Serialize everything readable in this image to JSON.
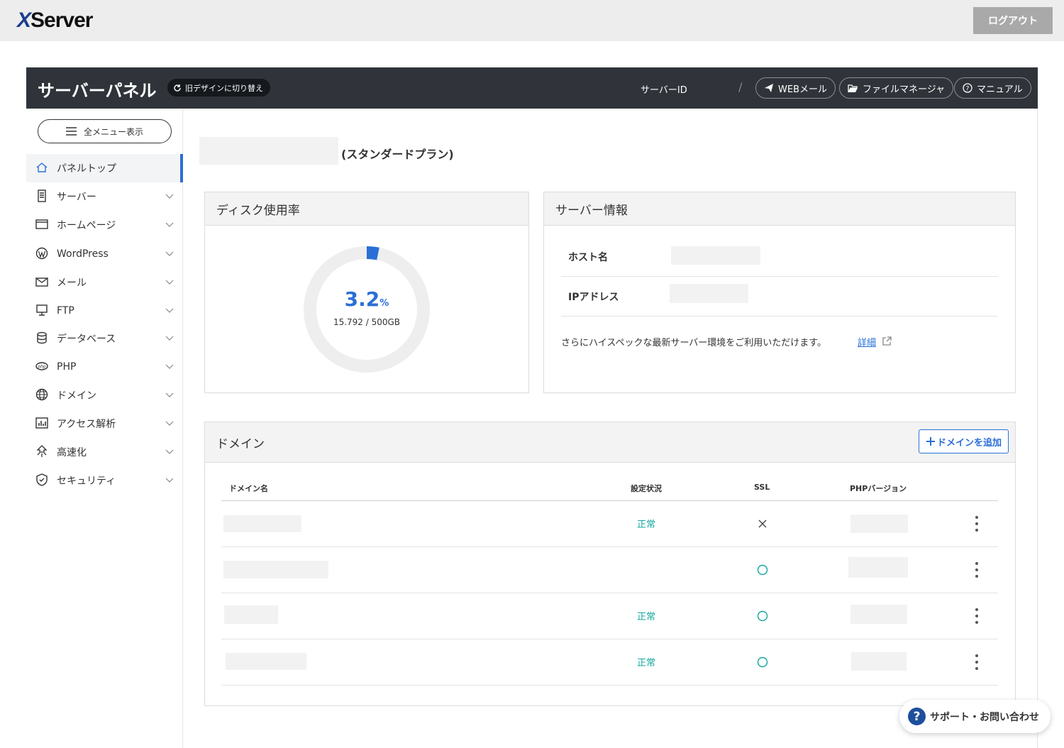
{
  "topbar": {
    "logo": "XServer",
    "logo_x": "X",
    "logo_rest": "Server",
    "logout_label": "ログアウト"
  },
  "panel": {
    "title": "サーバーパネル",
    "switch_label": "旧デザインに切り替え",
    "server_id_label": "サーバーID",
    "separator": "/",
    "buttons": {
      "webmail": "WEBメール",
      "filemanager": "ファイルマネージャ",
      "manual": "マニュアル"
    }
  },
  "sidebar": {
    "menu_button": "全メニュー表示",
    "items": [
      {
        "label": "パネルトップ",
        "icon": "home-icon"
      },
      {
        "label": "サーバー",
        "icon": "server-icon"
      },
      {
        "label": "ホームページ",
        "icon": "browser-icon"
      },
      {
        "label": "WordPress",
        "icon": "wordpress-icon"
      },
      {
        "label": "メール",
        "icon": "mail-icon"
      },
      {
        "label": "FTP",
        "icon": "monitor-icon"
      },
      {
        "label": "データベース",
        "icon": "database-icon"
      },
      {
        "label": "PHP",
        "icon": "php-icon"
      },
      {
        "label": "ドメイン",
        "icon": "globe-icon"
      },
      {
        "label": "アクセス解析",
        "icon": "chart-icon"
      },
      {
        "label": "高速化",
        "icon": "speed-icon"
      },
      {
        "label": "セキュリティ",
        "icon": "shield-icon"
      }
    ]
  },
  "main": {
    "plan_label": "(スタンダードプラン)",
    "disk": {
      "title": "ディスク使用率",
      "value": "3.2",
      "unit": "%",
      "fraction": 0.032,
      "detail": "15.792 / 500GB"
    },
    "server_info": {
      "title": "サーバー情報",
      "host_label": "ホスト名",
      "ip_label": "IPアドレス",
      "note": "さらにハイスペックな最新サーバー環境をご利用いただけます。",
      "link": "詳細"
    },
    "domains": {
      "title": "ドメイン",
      "add_label": "ドメインを追加",
      "columns": [
        "ドメイン名",
        "設定状況",
        "SSL",
        "PHPバージョン"
      ],
      "rows": [
        {
          "status": "正常",
          "ssl": "×"
        },
        {
          "status": "",
          "ssl": "○"
        },
        {
          "status": "正常",
          "ssl": "○"
        },
        {
          "status": "正常",
          "ssl": "○"
        }
      ]
    }
  },
  "support_label": "サポート・お問い合わせ",
  "colors": {
    "accent": "#2a6fd6",
    "ok": "#13a89e",
    "header": "#30343a"
  }
}
